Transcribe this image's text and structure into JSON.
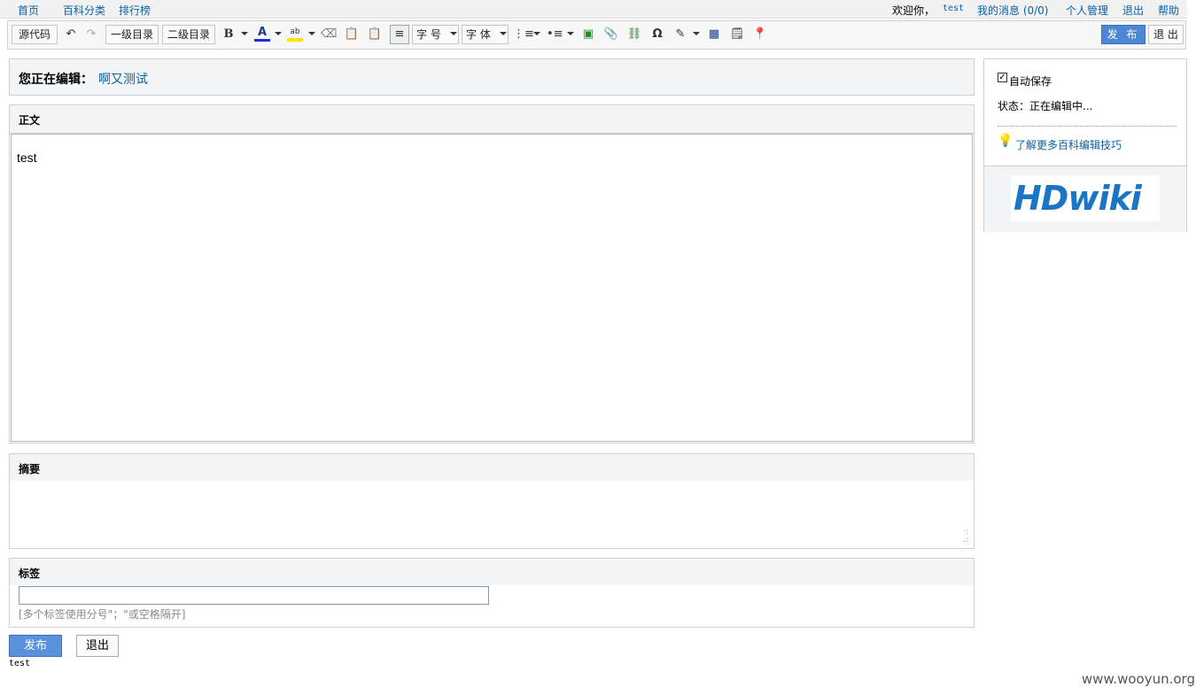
{
  "topnav": {
    "home": "首页",
    "categories": "百科分类",
    "ranking": "排行榜",
    "welcome": "欢迎你，",
    "username": "test",
    "messages": "我的消息 (0/0)",
    "account": "个人管理",
    "logout": "退出",
    "help": "帮助"
  },
  "toolbar": {
    "source": "源代码",
    "heading1": "一级目录",
    "heading2": "二级目录",
    "bold": "B",
    "font_color": "A",
    "font_size": "字 号",
    "font_family": "字 体",
    "special_char": "Ω",
    "publish": "发 布",
    "exit": "退 出"
  },
  "editing": {
    "label": "您正在编辑：",
    "title": "啊又测试"
  },
  "body_panel": {
    "heading": "正文",
    "content": "test"
  },
  "summary_panel": {
    "heading": "摘要",
    "value": ""
  },
  "tags_panel": {
    "heading": "标签",
    "value": "",
    "hint": "[多个标签使用分号\"；\"或空格隔开]"
  },
  "actions": {
    "publish": "发布",
    "exit": "退出"
  },
  "footer_user": "test",
  "sidebar": {
    "autosave": "自动保存",
    "autosave_checked": true,
    "status": "状态：正在编辑中...",
    "tips_link": "了解更多百科编辑技巧",
    "logo": "HDwiki"
  },
  "watermark": "www.wooyun.org",
  "colors": {
    "accent": "#4d88d6",
    "link": "#0b61a4",
    "panel_head": "#f2f5f8"
  }
}
